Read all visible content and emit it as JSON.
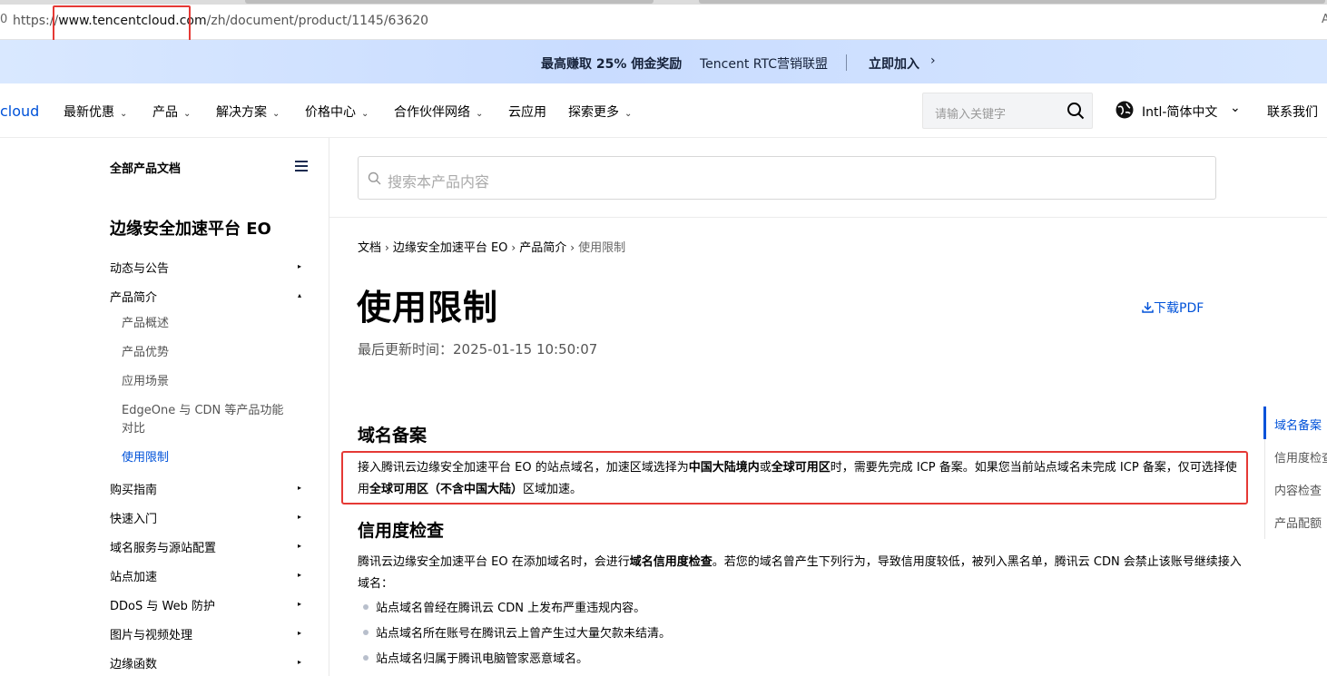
{
  "browser": {
    "url_scheme": "https://",
    "url_host": "www.tencentcloud.com",
    "url_path": "/zh/document/product/1145/63620",
    "left_glyph": "0",
    "right_glyph": "A"
  },
  "promo": {
    "bonus": "最高赚取 25% 佣金奖励",
    "program": "Tencent RTC营销联盟",
    "join": "立即加入",
    "chevron": "›"
  },
  "nav": {
    "logo": "cloud",
    "items": [
      {
        "label": "最新优惠",
        "chevron": "⌄"
      },
      {
        "label": "产品",
        "chevron": "⌄"
      },
      {
        "label": "解决方案",
        "chevron": "⌄"
      },
      {
        "label": "价格中心",
        "chevron": "⌄"
      },
      {
        "label": "合作伙伴网络",
        "chevron": "⌄"
      },
      {
        "label": "云应用",
        "chevron": ""
      },
      {
        "label": "探索更多",
        "chevron": "⌄"
      }
    ],
    "search_placeholder": "请输入关键字",
    "language": "Intl-简体中文",
    "language_chevron": "⌄",
    "contact": "联系我们"
  },
  "sidebar": {
    "all_docs": "全部产品文档",
    "product_title": "边缘安全加速平台 EO",
    "items": [
      {
        "label": "动态与公告",
        "arrow": "▸"
      },
      {
        "label": "产品简介",
        "arrow": "▴"
      },
      {
        "label": "购买指南",
        "arrow": "▸"
      },
      {
        "label": "快速入门",
        "arrow": "▸"
      },
      {
        "label": "域名服务与源站配置",
        "arrow": "▸"
      },
      {
        "label": "站点加速",
        "arrow": "▸"
      },
      {
        "label": "DDoS 与 Web 防护",
        "arrow": "▸"
      },
      {
        "label": "图片与视频处理",
        "arrow": "▸"
      },
      {
        "label": "边缘函数",
        "arrow": "▸"
      }
    ],
    "sub_items": [
      {
        "label": "产品概述"
      },
      {
        "label": "产品优势"
      },
      {
        "label": "应用场景"
      },
      {
        "label": "EdgeOne 与 CDN 等产品功能对比"
      },
      {
        "label": "使用限制"
      }
    ]
  },
  "content": {
    "search_placeholder": "搜索本产品内容",
    "breadcrumb": [
      "文档",
      "边缘安全加速平台 EO",
      "产品简介",
      "使用限制"
    ],
    "breadcrumb_sep": "›",
    "title": "使用限制",
    "download": "下载PDF",
    "updated": "最后更新时间：2025-01-15 10:50:07",
    "sections": [
      {
        "heading": "域名备案",
        "para_parts": [
          "接入腾讯云边缘安全加速平台 EO 的站点域名，加速区域选择为",
          "中国大陆境内",
          "或",
          "全球可用区",
          "时，需要先完成 ICP 备案。如果您当前站点域名未完成 ICP 备案，仅可选择使用",
          "全球可用区（不含中国大陆）",
          "区域加速。"
        ]
      },
      {
        "heading": "信用度检查",
        "para_parts": [
          "腾讯云边缘安全加速平台 EO 在添加域名时，会进行",
          "域名信用度检查",
          "。若您的域名曾产生下列行为，导致信用度较低，被列入黑名单，腾讯云 CDN 会禁止该账号继续接入域名："
        ],
        "bullets": [
          "站点域名曾经在腾讯云 CDN 上发布严重违规内容。",
          "站点域名所在账号在腾讯云上曾产生过大量欠款未结清。",
          "站点域名归属于腾讯电脑管家恶意域名。"
        ]
      }
    ]
  },
  "toc": [
    "域名备案",
    "信用度检查",
    "内容检查",
    "产品配额"
  ],
  "colors": {
    "accent": "#0052d9",
    "highlight": "#e53935"
  }
}
